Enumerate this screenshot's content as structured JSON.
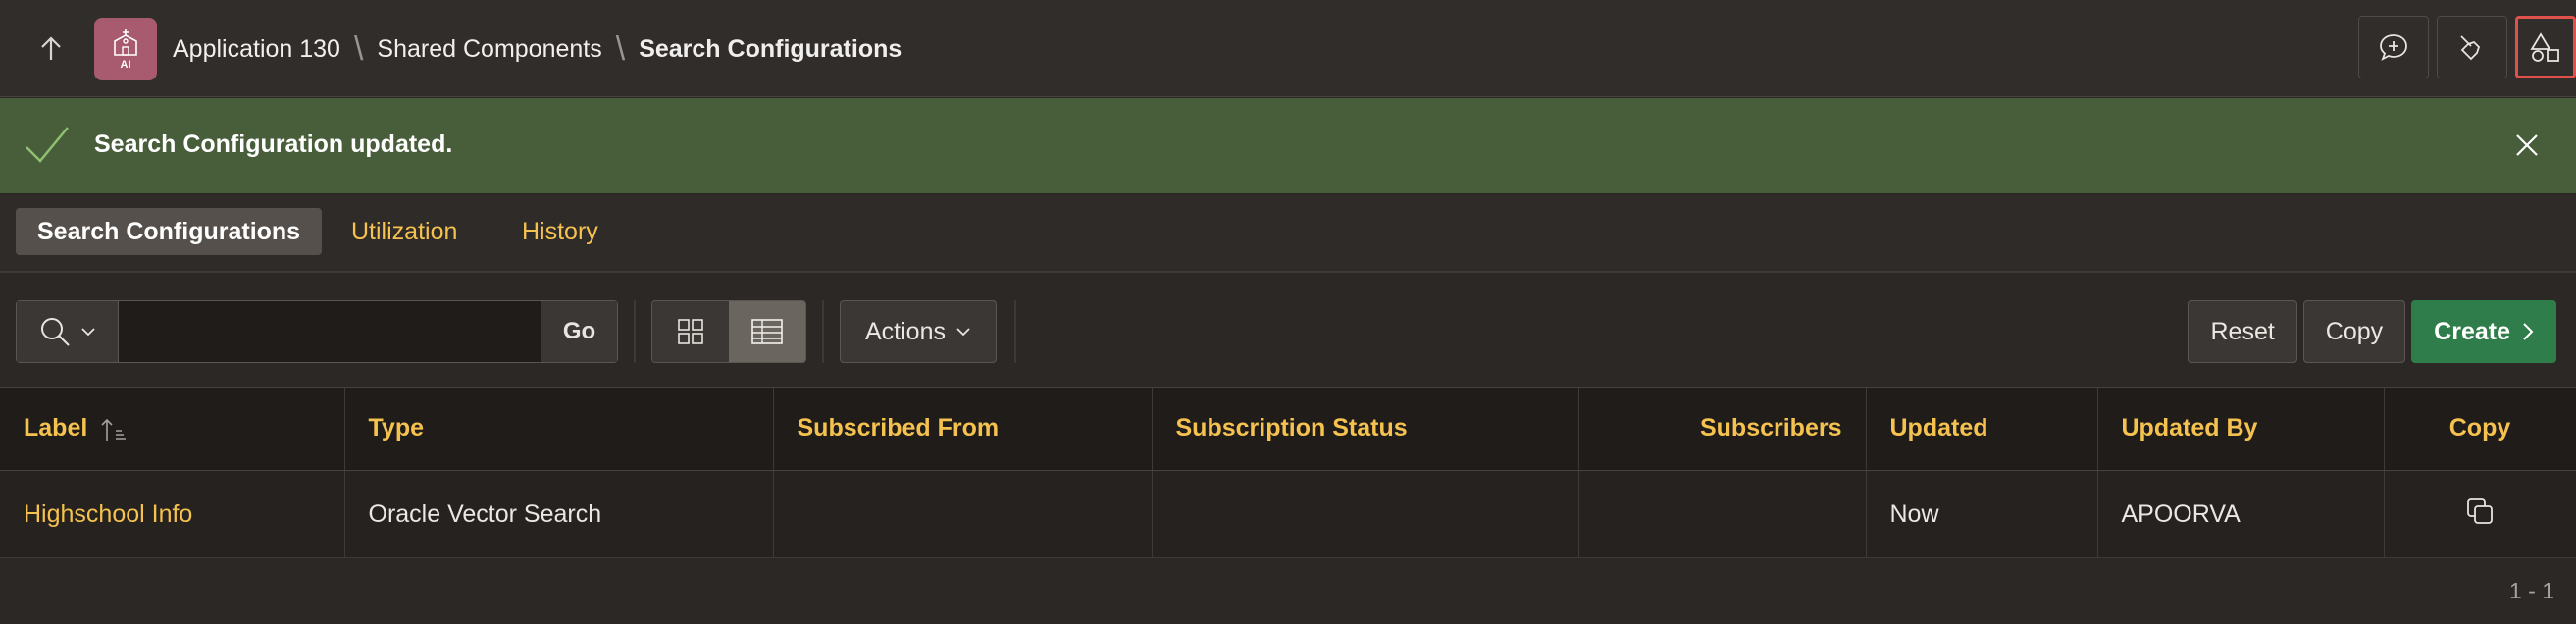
{
  "header": {
    "breadcrumbs": [
      "Application 130",
      "Shared Components",
      "Search Configurations"
    ],
    "app_icon_label": "AI",
    "icons": [
      "arrow-up-icon",
      "comment-plus-icon",
      "broom-icon",
      "shapes-icon"
    ]
  },
  "alert": {
    "message": "Search Configuration updated.",
    "color": "#485e3b"
  },
  "tabs": [
    {
      "label": "Search Configurations",
      "active": true
    },
    {
      "label": "Utilization",
      "active": false
    },
    {
      "label": "History",
      "active": false
    }
  ],
  "toolbar": {
    "search_value": "",
    "go_label": "Go",
    "actions_label": "Actions",
    "reset_label": "Reset",
    "copy_label": "Copy",
    "create_label": "Create"
  },
  "table": {
    "columns": [
      "Label",
      "Type",
      "Subscribed From",
      "Subscription Status",
      "Subscribers",
      "Updated",
      "Updated By",
      "Copy"
    ],
    "rows": [
      {
        "label": "Highschool Info",
        "type": "Oracle Vector Search",
        "subscribed_from": "",
        "subscription_status": "",
        "subscribers": "",
        "updated": "Now",
        "updated_by": "APOORVA"
      }
    ]
  },
  "pagination": "1 - 1",
  "colors": {
    "accent_link": "#f5c24f",
    "create_button": "#2f7d4a",
    "highlight_border": "#e0514c"
  }
}
